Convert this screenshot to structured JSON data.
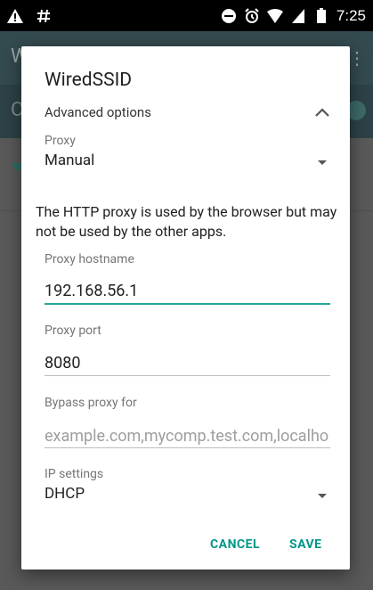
{
  "status_bar": {
    "left_icons": [
      "warning-icon",
      "hash-icon"
    ],
    "right_icons": [
      "dnd-icon",
      "alarm-icon",
      "wifi-icon",
      "signal-icon",
      "battery-icon"
    ],
    "time": "7:25"
  },
  "background": {
    "appbar_title": "W",
    "subbar_title": "O"
  },
  "dialog": {
    "title": "WiredSSID",
    "advanced_options_label": "Advanced options",
    "proxy": {
      "label": "Proxy",
      "value": "Manual"
    },
    "proxy_note": "The HTTP proxy is used by the browser but may not be used by the other apps.",
    "proxy_hostname": {
      "label": "Proxy hostname",
      "value": "192.168.56.1"
    },
    "proxy_port": {
      "label": "Proxy port",
      "value": "8080"
    },
    "bypass_proxy": {
      "label": "Bypass proxy for",
      "placeholder": "example.com,mycomp.test.com,localhost"
    },
    "ip_settings": {
      "label": "IP settings",
      "value": "DHCP"
    },
    "buttons": {
      "cancel": "CANCEL",
      "save": "SAVE"
    }
  },
  "colors": {
    "accent": "#009688",
    "focus_underline": "#26a69a"
  }
}
